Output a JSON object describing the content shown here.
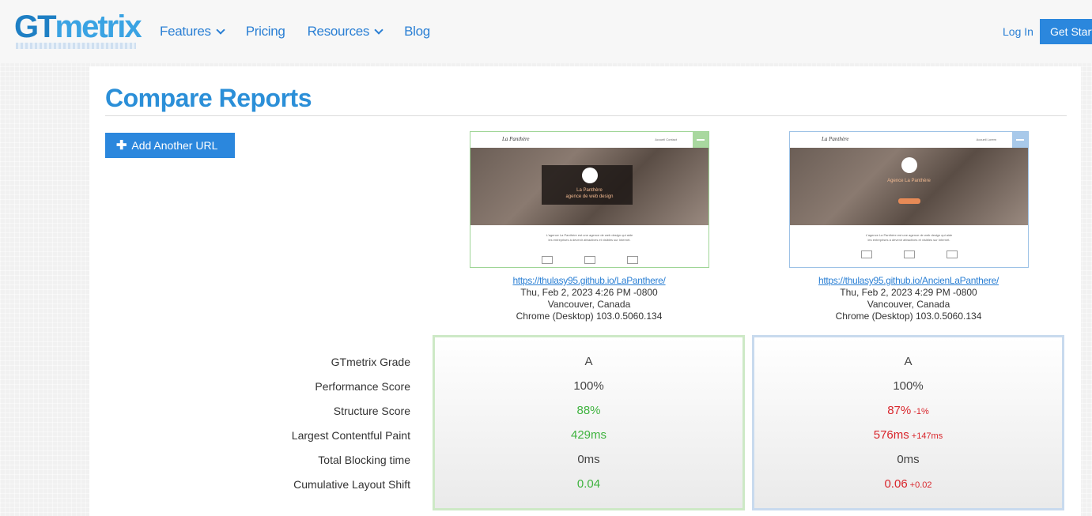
{
  "header": {
    "logo_gt": "GT",
    "logo_metrix": "metrix",
    "nav": [
      {
        "label": "Features",
        "dropdown": true
      },
      {
        "label": "Pricing",
        "dropdown": false
      },
      {
        "label": "Resources",
        "dropdown": true
      },
      {
        "label": "Blog",
        "dropdown": false
      }
    ],
    "login": "Log In",
    "get_started": "Get Started"
  },
  "page": {
    "title": "Compare Reports",
    "add_url_button": "Add Another URL"
  },
  "reports": [
    {
      "url": "https://thulasy95.github.io/LaPanthere/",
      "date": "Thu, Feb 2, 2023 4:26 PM -0800",
      "location": "Vancouver, Canada",
      "browser": "Chrome (Desktop) 103.0.5060.134",
      "accent": "#9fd596",
      "thumbnail": {
        "brand": "La Panthère",
        "links": "Accueil   Contact",
        "hero_text_1": "La Panthère",
        "hero_text_2": "agence de web design",
        "body_text_1": "L'agence La Panthère est une agence de web design qui aide",
        "body_text_2": "les entreprises à devenir attractives et visibles sur Internet."
      },
      "metrics": {
        "grade": "A",
        "performance": "100%",
        "structure": "88%",
        "lcp": "429ms",
        "tbt": "0ms",
        "cls": "0.04"
      }
    },
    {
      "url": "https://thulasy95.github.io/AncienLaPanthere/",
      "date": "Thu, Feb 2, 2023 4:29 PM -0800",
      "location": "Vancouver, Canada",
      "browser": "Chrome (Desktop) 103.0.5060.134",
      "accent": "#9dc2e6",
      "thumbnail": {
        "brand": "La Panthère",
        "links": "Accueil   Lorem",
        "hero_text_1": "Agence La Panthère",
        "hero_text_2": "",
        "body_text_1": "L'agence La Panthère est une agence de web design qui aide",
        "body_text_2": "les entreprises à devenir attractives et visibles sur Internet."
      },
      "metrics": {
        "grade": "A",
        "performance": "100%",
        "structure": "87%",
        "structure_delta": "-1%",
        "lcp": "576ms",
        "lcp_delta": "+147ms",
        "tbt": "0ms",
        "cls": "0.06",
        "cls_delta": "+0.02"
      }
    }
  ],
  "metric_labels": [
    "GTmetrix Grade",
    "Performance Score",
    "Structure Score",
    "Largest Contentful Paint",
    "Total Blocking time",
    "Cumulative Layout Shift"
  ],
  "colors": {
    "brand_blue": "#2b87dd",
    "good_green": "#3fb33f",
    "bad_red": "#d9262c"
  }
}
